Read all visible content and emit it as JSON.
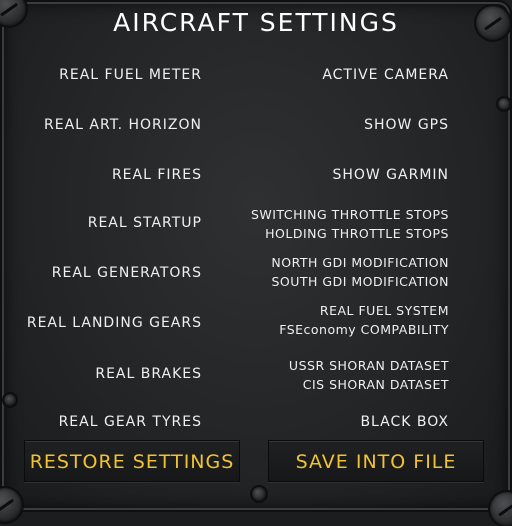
{
  "title": "AIRCRAFT SETTINGS",
  "left_options": [
    "REAL FUEL METER",
    "REAL ART. HORIZON",
    "REAL FIRES",
    "REAL STARTUP",
    "REAL GENERATORS",
    "REAL LANDING GEARS",
    "REAL BRAKES",
    "REAL GEAR TYRES"
  ],
  "right_options": [
    {
      "lines": [
        "ACTIVE CAMERA"
      ]
    },
    {
      "lines": [
        "SHOW GPS"
      ]
    },
    {
      "lines": [
        "SHOW GARMIN"
      ]
    },
    {
      "lines": [
        "SWITCHING THROTTLE STOPS",
        "HOLDING THROTTLE STOPS"
      ]
    },
    {
      "lines": [
        "NORTH GDI MODIFICATION",
        "SOUTH GDI MODIFICATION"
      ]
    },
    {
      "lines": [
        "REAL FUEL SYSTEM",
        "FSEconomy COMPABILITY"
      ]
    },
    {
      "lines": [
        "USSR SHORAN DATASET",
        "CIS SHORAN DATASET"
      ]
    },
    {
      "lines": [
        "BLACK BOX"
      ]
    }
  ],
  "buttons": {
    "restore": "RESTORE SETTINGS",
    "save": "SAVE INTO FILE"
  },
  "colors": {
    "button_text": "#f1c232",
    "label_text": "#f0f0f0"
  }
}
